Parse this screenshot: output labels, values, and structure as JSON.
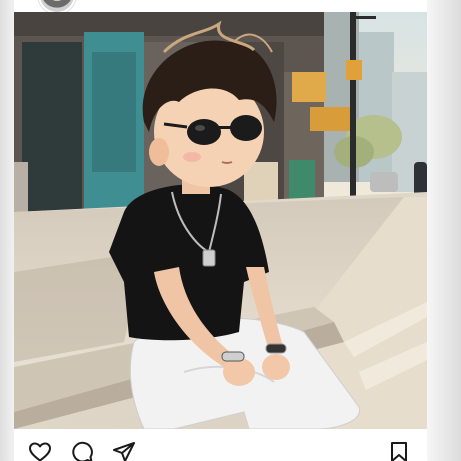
{
  "post": {
    "author_avatar": "user-avatar",
    "image": "illustration-boy-with-sunglasses-on-sidewalk",
    "actions": [
      {
        "name": "like",
        "icon": "heart-icon"
      },
      {
        "name": "comment",
        "icon": "comment-icon"
      },
      {
        "name": "share",
        "icon": "send-icon"
      },
      {
        "name": "save",
        "icon": "bookmark-icon"
      }
    ]
  },
  "colors": {
    "background": "#e9e9ea",
    "card": "#ffffff",
    "icon": "#1a1a1a",
    "shirt": "#141414",
    "pants": "#f2f2f2",
    "hair": "#2a1e17"
  }
}
